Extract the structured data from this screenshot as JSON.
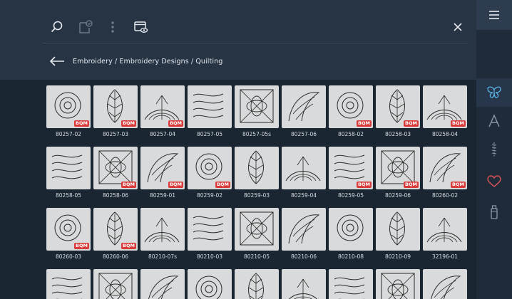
{
  "breadcrumb": "Embroidery / Embroidery Designs / Quilting",
  "badge_text": "BQM",
  "colors": {
    "accent": "#5bb6e8",
    "heart": "#e2545c",
    "badge": "#d93a3a"
  },
  "icons": {
    "toolbar": [
      "search-icon",
      "document-check-icon",
      "more-vertical-icon",
      "preview-window-icon"
    ],
    "close": "close-icon",
    "back": "arrow-left-icon",
    "menu": "menu-icon",
    "sidebar": [
      "butterfly-icon",
      "font-letter-icon",
      "stitch-icon",
      "heart-icon",
      "thread-spool-icon"
    ]
  },
  "designs": [
    {
      "label": "80257-02",
      "badge": true
    },
    {
      "label": "80257-03",
      "badge": true
    },
    {
      "label": "80257-04",
      "badge": true
    },
    {
      "label": "80257-05",
      "badge": false
    },
    {
      "label": "80257-05s",
      "badge": false
    },
    {
      "label": "80257-06",
      "badge": false
    },
    {
      "label": "80258-02",
      "badge": true
    },
    {
      "label": "80258-03",
      "badge": true
    },
    {
      "label": "80258-04",
      "badge": true
    },
    {
      "label": "80258-05",
      "badge": false
    },
    {
      "label": "80258-06",
      "badge": true
    },
    {
      "label": "80259-01",
      "badge": true
    },
    {
      "label": "80259-02",
      "badge": true
    },
    {
      "label": "80259-03",
      "badge": false
    },
    {
      "label": "80259-04",
      "badge": false
    },
    {
      "label": "80259-05",
      "badge": true
    },
    {
      "label": "80259-06",
      "badge": true
    },
    {
      "label": "80260-02",
      "badge": true
    },
    {
      "label": "80260-03",
      "badge": true
    },
    {
      "label": "80260-06",
      "badge": true
    },
    {
      "label": "80210-07s",
      "badge": false
    },
    {
      "label": "80210-03",
      "badge": false
    },
    {
      "label": "80210-05",
      "badge": false
    },
    {
      "label": "80210-06",
      "badge": false
    },
    {
      "label": "80210-08",
      "badge": false
    },
    {
      "label": "80210-09",
      "badge": false
    },
    {
      "label": "32196-01",
      "badge": false
    },
    {
      "label": "",
      "badge": false
    },
    {
      "label": "",
      "badge": false
    },
    {
      "label": "",
      "badge": false
    },
    {
      "label": "",
      "badge": false
    },
    {
      "label": "",
      "badge": false
    },
    {
      "label": "",
      "badge": false
    },
    {
      "label": "",
      "badge": false
    },
    {
      "label": "",
      "badge": false
    },
    {
      "label": "",
      "badge": false
    }
  ]
}
